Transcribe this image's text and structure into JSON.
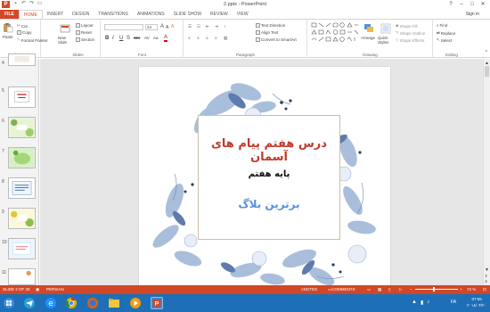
{
  "window": {
    "title": "2.pptx - PowerPoint",
    "app_icon": "P",
    "controls": [
      "?",
      "–",
      "□",
      "✕"
    ]
  },
  "tabs": [
    "FILE",
    "HOME",
    "INSERT",
    "DESIGN",
    "TRANSITIONS",
    "ANIMATIONS",
    "SLIDE SHOW",
    "REVIEW",
    "VIEW"
  ],
  "sign_in": "Sign in",
  "ribbon": {
    "clipboard": {
      "paste": "Paste",
      "cut": "Cut",
      "copy": "Copy",
      "format_painter": "Format Painter",
      "label": "Clipboard"
    },
    "slides": {
      "new_slide": "New Slide",
      "layout": "Layout",
      "reset": "Reset",
      "section": "Section",
      "label": "Slides"
    },
    "font": {
      "size": "24",
      "label": "Font",
      "bold": "B",
      "italic": "I",
      "underline": "U",
      "strike": "S",
      "shadow": "abc",
      "spacing": "AV",
      "case": "Aa"
    },
    "paragraph": {
      "text_direction": "Text Direction",
      "align_text": "Align Text",
      "convert_smartart": "Convert to SmartArt",
      "label": "Paragraph"
    },
    "drawing": {
      "arrange": "Arrange",
      "quick_styles": "Quick Styles",
      "shape_fill": "Shape Fill",
      "shape_outline": "Shape Outline",
      "shape_effects": "Shape Effects",
      "label": "Drawing"
    },
    "editing": {
      "find": "Find",
      "replace": "Replace",
      "select": "Select",
      "label": "Editing"
    }
  },
  "thumbnails": [
    "4",
    "5",
    "6",
    "7",
    "8",
    "9",
    "10",
    "11"
  ],
  "slide": {
    "title": "درس هفتم پیام های آسمان",
    "subtitle": "پایه هفتم",
    "author": "برترین بلاگ"
  },
  "status": {
    "slide_info": "SLIDE 2 OF 29",
    "language": "PERSIAN",
    "notes": "NOTES",
    "comments": "COMMENTS",
    "zoom": "74 %"
  },
  "taskbar": {
    "time": "07:55",
    "lang": "FA",
    "date": "۲۰۱۸/۰۴/۲۰"
  },
  "colors": {
    "accent": "#d24726",
    "taskbar": "#1d6fb8",
    "title_red": "#c0392b",
    "title_blue": "#5b8fd6"
  }
}
